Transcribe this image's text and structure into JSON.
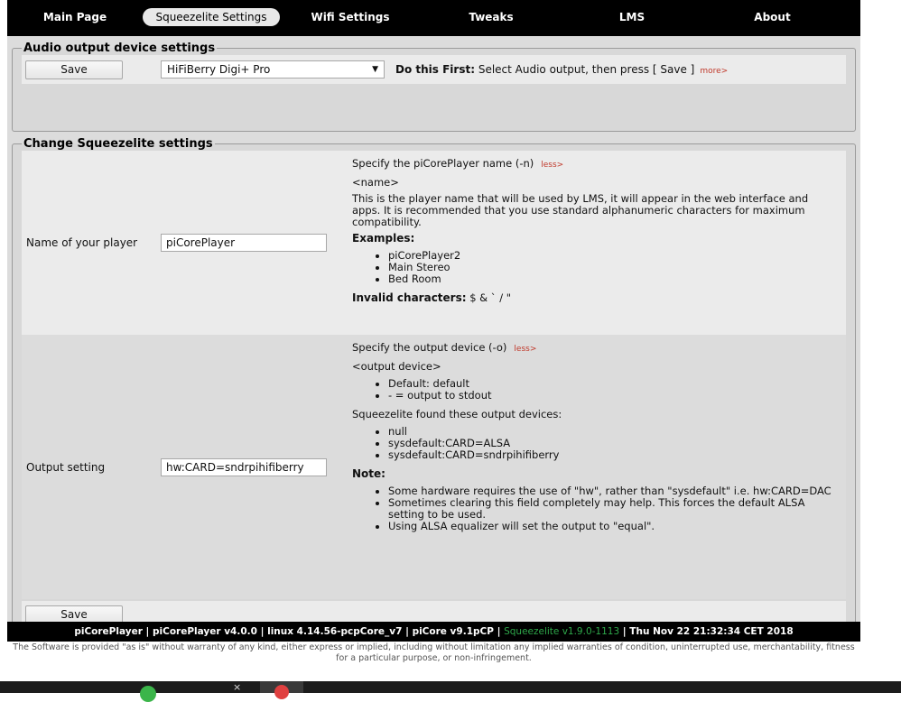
{
  "nav": [
    {
      "label": "Main Page",
      "active": false
    },
    {
      "label": "Squeezelite Settings",
      "active": true
    },
    {
      "label": "Wifi Settings",
      "active": false
    },
    {
      "label": "Tweaks",
      "active": false
    },
    {
      "label": "LMS",
      "active": false
    },
    {
      "label": "About",
      "active": false
    }
  ],
  "audio": {
    "legend": "Audio output device settings",
    "save_label": "Save",
    "selected_device": "HiFiBerry Digi+ Pro",
    "note_bold": "Do this First:",
    "note_text": " Select Audio output, then press [ Save ]",
    "more": "more>"
  },
  "squeeze": {
    "legend": "Change Squeezelite settings",
    "save_label": "Save",
    "name_row": {
      "label": "Name of your player",
      "value": "piCorePlayer",
      "title": "Specify the piCorePlayer name (-n)",
      "less": "less>",
      "syntax": "<name>",
      "description": "This is the player name that will be used by LMS, it will appear in the web interface and apps. It is recommended that you use standard alphanumeric characters for maximum compatibility.",
      "examples_heading": "Examples:",
      "examples": [
        "piCorePlayer2",
        "Main Stereo",
        "Bed Room"
      ],
      "invalid_label": "Invalid characters:",
      "invalid_chars": " $ & ` / \""
    },
    "output_row": {
      "label": "Output setting",
      "value": "hw:CARD=sndrpihifiberry",
      "title": "Specify the output device (-o)",
      "less": "less>",
      "syntax": "<output device>",
      "defaults": [
        "Default: default",
        "- = output to stdout"
      ],
      "found_text": "Squeezelite found these output devices:",
      "devices": [
        "null",
        "sysdefault:CARD=ALSA",
        "sysdefault:CARD=sndrpihifiberry"
      ],
      "note_heading": "Note:",
      "notes": [
        "Some hardware requires the use of \"hw\", rather than \"sysdefault\" i.e. hw:CARD=DAC",
        "Sometimes clearing this field completely may help. This forces the default ALSA setting to be used.",
        "Using ALSA equalizer will set the output to \"equal\"."
      ]
    }
  },
  "footer": {
    "part1": "piCorePlayer | piCorePlayer v4.0.0 | linux 4.14.56-pcpCore_v7 | piCore v9.1pCP | ",
    "squeezelite": "Squeezelite v1.9.0-1113",
    "part2": " | Thu Nov 22 21:32:34 CET 2018",
    "disclaimer": "The Software is provided \"as is\" without warranty of any kind, either express or implied, including without limitation any implied warranties of condition, uninterrupted use, merchantability, fitness for a particular purpose, or non-infringement."
  },
  "colors": {
    "accent_red": "#c0392b",
    "footer_green": "#2ea84a",
    "panel_light": "#ebebeb",
    "panel_dark": "#dcdcdc"
  },
  "taskbar": {
    "icon_x": "×"
  }
}
